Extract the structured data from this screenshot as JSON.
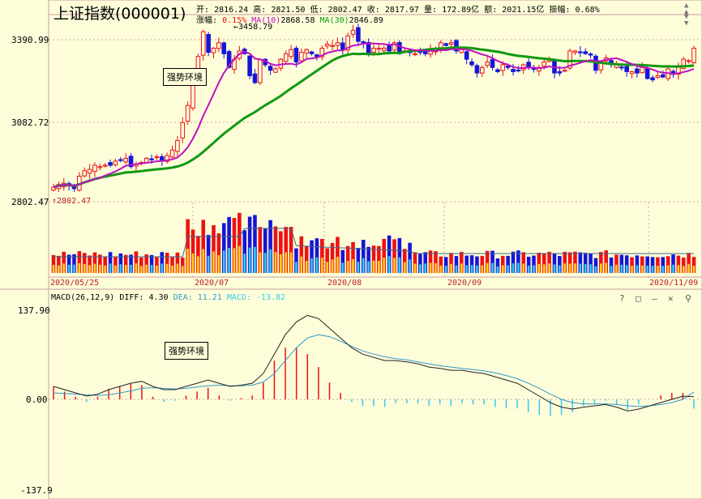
{
  "header": {
    "title": "上证指数(000001)",
    "open_label": "开:",
    "open": "2816.24",
    "high_label": "高:",
    "high": "2821.50",
    "low_label": "低:",
    "low": "2802.47",
    "close_label": "收:",
    "close": "2817.97",
    "volume_label": "量:",
    "volume": "172.89亿",
    "amount_label": "额:",
    "amount": "2021.15亿",
    "amplitude_label": "振幅:",
    "amplitude": "0.68%",
    "change_label": "涨幅:",
    "change": "0.15%",
    "ma10_label": "MA(10)",
    "ma10": "2868.58",
    "ma30_label": "MA(30)",
    "ma30": "2846.89"
  },
  "price_axis": {
    "top": "3390.99",
    "mid": "3082.72",
    "low": "2802.47"
  },
  "annotations": {
    "max": "3458.79",
    "min": "2802.47",
    "note": "强势环境"
  },
  "x_labels": [
    "2020/05/25",
    "2020/07",
    "2020/08",
    "2020/09",
    "2020/11/09"
  ],
  "macd": {
    "label": "MACD(26,12,9)",
    "diff_label": "DIFF:",
    "diff": "4.30",
    "dea_label": "DEA:",
    "dea": "11.21",
    "macd_label": "MACD:",
    "macd": "-13.82",
    "axis_top": "137.90",
    "axis_mid": "0.00",
    "axis_bottom": "-137.9"
  },
  "toolbar": {
    "help": "?",
    "restore": "□",
    "minimize": "—",
    "settings": "⚲"
  },
  "colors": {
    "up": "#ee1111",
    "down": "#1515d8",
    "ma10": "#c010c0",
    "ma30": "#119911",
    "dea": "#3399cc",
    "diff": "#222222",
    "vol_up_inner": "#ffd21a",
    "vol_down_inner": "#33ccee",
    "background": "#fdfdda"
  },
  "chart_data": {
    "type": "candlestick",
    "title": "上证指数(000001)",
    "date_range": [
      "2020/05/25",
      "2020/11/09"
    ],
    "approx_close": [
      2855,
      2865,
      2870,
      2860,
      2850,
      2895,
      2915,
      2920,
      2935,
      2930,
      2935,
      2935,
      2950,
      2955,
      2960,
      2930,
      2938,
      2945,
      2960,
      2955,
      2966,
      2950,
      2970,
      2990,
      3025,
      3090,
      3152,
      3260,
      3330,
      3420,
      3345,
      3360,
      3380,
      3340,
      3290,
      3320,
      3350,
      3340,
      3260,
      3235,
      3320,
      3300,
      3280,
      3285,
      3320,
      3340,
      3355,
      3310,
      3345,
      3355,
      3340,
      3330,
      3360,
      3375,
      3370,
      3380,
      3355,
      3405,
      3425,
      3385,
      3380,
      3340,
      3360,
      3360,
      3360,
      3350,
      3380,
      3340,
      3350,
      3345,
      3340,
      3345,
      3340,
      3355,
      3360,
      3380,
      3370,
      3380,
      3350,
      3355,
      3320,
      3300,
      3270,
      3290,
      3310,
      3290,
      3275,
      3300,
      3290,
      3275,
      3280,
      3300,
      3290,
      3285,
      3290,
      3310,
      3320,
      3270,
      3270,
      3280,
      3350,
      3350,
      3345,
      3340,
      3335,
      3280,
      3310,
      3325,
      3300,
      3300,
      3290,
      3275,
      3275,
      3270,
      3290,
      3250,
      3245,
      3260,
      3255,
      3285,
      3265,
      3295,
      3320,
      3315,
      3360
    ],
    "ma10_endpoint": 2868.58,
    "ma30_endpoint": 2846.89,
    "price_ticks": [
      2802.47,
      3082.72,
      3390.99
    ],
    "max_price": 3458.79,
    "min_price": 2802.47,
    "macd_series": {
      "diff_approx": [
        20,
        15,
        10,
        5,
        8,
        15,
        20,
        25,
        28,
        20,
        15,
        15,
        20,
        25,
        30,
        25,
        20,
        22,
        25,
        40,
        70,
        100,
        120,
        130,
        125,
        110,
        95,
        80,
        70,
        65,
        60,
        60,
        58,
        55,
        50,
        48,
        45,
        45,
        42,
        40,
        35,
        30,
        25,
        15,
        5,
        -5,
        -12,
        -15,
        -12,
        -10,
        -8,
        -12,
        -18,
        -15,
        -10,
        -5,
        0,
        5,
        4
      ],
      "dea_approx": [
        10,
        9,
        8,
        7,
        6,
        7,
        10,
        13,
        17,
        18,
        17,
        16,
        17,
        19,
        21,
        22,
        21,
        21,
        22,
        27,
        40,
        60,
        80,
        95,
        100,
        97,
        90,
        82,
        75,
        70,
        66,
        63,
        61,
        58,
        55,
        52,
        50,
        48,
        46,
        44,
        41,
        37,
        32,
        25,
        17,
        8,
        0,
        -5,
        -7,
        -7,
        -7,
        -8,
        -10,
        -11,
        -10,
        -8,
        -5,
        0,
        11.21
      ],
      "macd_hist_latest": -13.82,
      "axis_range": [
        -137.9,
        137.9
      ]
    }
  }
}
